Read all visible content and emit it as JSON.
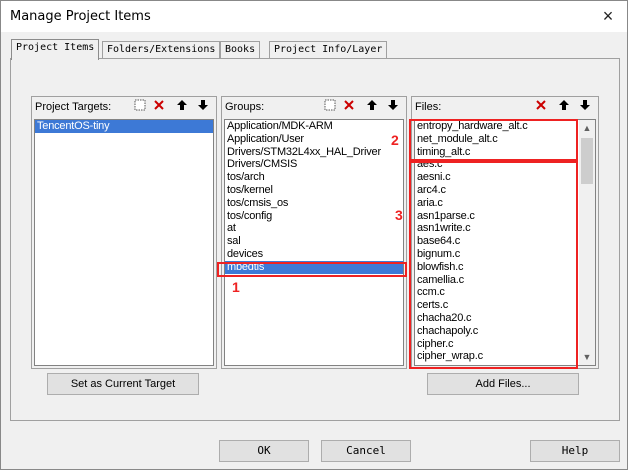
{
  "window": {
    "title": "Manage Project Items",
    "close_icon": "×"
  },
  "tabs": [
    {
      "label": "Project Items",
      "active": true
    },
    {
      "label": "Folders/Extensions"
    },
    {
      "label": "Books"
    },
    {
      "label": "Project Info/Layer"
    }
  ],
  "targets": {
    "label": "Project Targets:",
    "items": [
      "TencentOS-tiny"
    ],
    "selected_index": 0,
    "set_current_label": "Set as Current Target"
  },
  "groups": {
    "label": "Groups:",
    "items": [
      "Application/MDK-ARM",
      "Application/User",
      "Drivers/STM32L4xx_HAL_Driver",
      "Drivers/CMSIS",
      "tos/arch",
      "tos/kernel",
      "tos/cmsis_os",
      "tos/config",
      "at",
      "sal",
      "devices",
      "mbedtls"
    ],
    "selected_index": 11
  },
  "files": {
    "label": "Files:",
    "items": [
      "entropy_hardware_alt.c",
      "net_module_alt.c",
      "timing_alt.c",
      "aes.c",
      "aesni.c",
      "arc4.c",
      "aria.c",
      "asn1parse.c",
      "asn1write.c",
      "base64.c",
      "bignum.c",
      "blowfish.c",
      "camellia.c",
      "ccm.c",
      "certs.c",
      "chacha20.c",
      "chachapoly.c",
      "cipher.c",
      "cipher_wrap.c"
    ],
    "add_files_label": "Add Files..."
  },
  "annotations": {
    "one": "1",
    "two": "2",
    "three": "3",
    "color": "#e22222"
  },
  "footer": {
    "ok": "OK",
    "cancel": "Cancel",
    "help": "Help"
  },
  "icons": {
    "new": "new-item-icon",
    "delete": "delete-icon",
    "up": "move-up-icon",
    "down": "move-down-icon"
  }
}
